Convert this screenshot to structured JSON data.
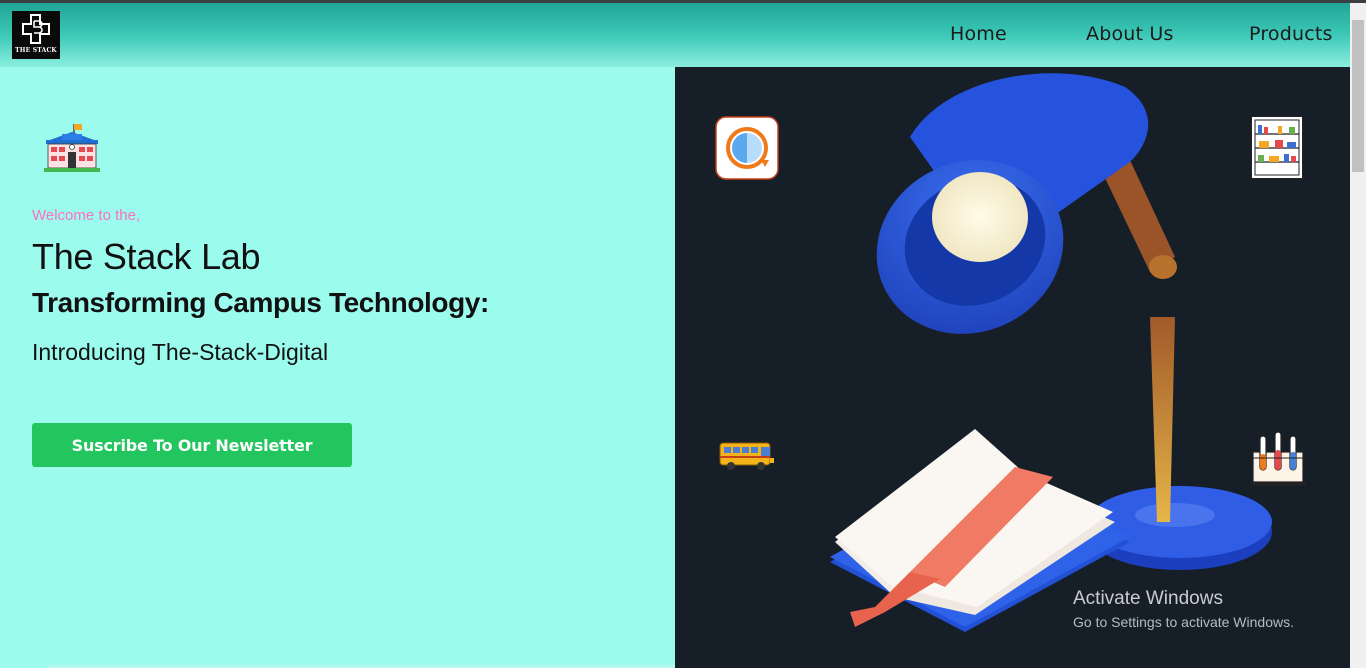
{
  "header": {
    "logo_text": "THE STACK",
    "nav": [
      {
        "label": "Home"
      },
      {
        "label": "About Us"
      },
      {
        "label": "Products"
      }
    ]
  },
  "hero": {
    "welcome": "Welcome to the,",
    "title": "The Stack Lab",
    "subtitle": "Transforming Campus Technology:",
    "intro": "Introducing The-Stack-Digital",
    "cta_label": "Suscribe To Our Newsletter"
  },
  "icons": {
    "hero_left": "school-building-icon",
    "top_left": "sync-circle-icon",
    "top_right": "library-shelf-icon",
    "bottom_left": "school-bus-icon",
    "bottom_right": "test-tubes-icon",
    "illustration": "desk-lamp-and-book-illustration"
  },
  "windows_watermark": {
    "title": "Activate Windows",
    "subtitle": "Go to Settings to activate Windows."
  },
  "colors": {
    "header_gradient_top": "#1fa596",
    "header_gradient_bottom": "#8aeede",
    "left_panel_bg": "#9bfcee",
    "right_panel_bg": "#161e28",
    "welcome_text": "#ff6fbf",
    "cta_bg": "#22c55e"
  }
}
